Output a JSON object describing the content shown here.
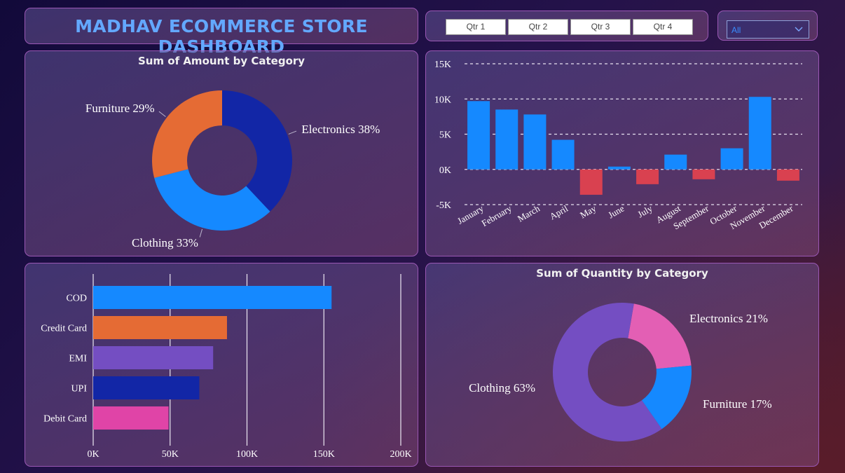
{
  "header": {
    "title": "MADHAV ECOMMERCE STORE DASHBOARD"
  },
  "slicer": {
    "quarters": [
      "Qtr 1",
      "Qtr 2",
      "Qtr 3",
      "Qtr 4"
    ]
  },
  "dropdown": {
    "value": "All"
  },
  "colors": {
    "blue": "#1589ff",
    "navy": "#1226a6",
    "orange": "#e56b34",
    "purple": "#744ec2",
    "pink": "#e044a7",
    "pink_light": "#e35fb4",
    "red": "#d94150",
    "title": "#63a8ff"
  },
  "chart_data": [
    {
      "type": "pie",
      "variant": "donut",
      "title": "Sum of Amount by Category",
      "categories": [
        "Electronics",
        "Clothing",
        "Furniture"
      ],
      "values": [
        38,
        33,
        29
      ],
      "labels": [
        "Electronics 38%",
        "Clothing 33%",
        "Furniture 29%"
      ],
      "colors": [
        "#1226a6",
        "#1589ff",
        "#e56b34"
      ]
    },
    {
      "type": "bar",
      "title": "",
      "categories": [
        "January",
        "February",
        "March",
        "April",
        "May",
        "June",
        "July",
        "August",
        "September",
        "October",
        "November",
        "December"
      ],
      "values": [
        9700,
        8500,
        7800,
        4200,
        -3600,
        400,
        -2100,
        2100,
        -1400,
        3000,
        10300,
        -1600
      ],
      "ylim": [
        -5000,
        15000
      ],
      "yticks": [
        -5000,
        0,
        5000,
        10000,
        15000
      ],
      "ytick_labels": [
        "-5K",
        "0K",
        "5K",
        "10K",
        "15K"
      ],
      "grid": true,
      "positive_color": "#1589ff",
      "negative_color": "#d94150"
    },
    {
      "type": "bar",
      "orientation": "horizontal",
      "title": "",
      "categories": [
        "COD",
        "Credit Card",
        "EMI",
        "UPI",
        "Debit Card"
      ],
      "values": [
        155000,
        87000,
        78000,
        69000,
        49000
      ],
      "xlim": [
        0,
        200000
      ],
      "xticks": [
        0,
        50000,
        100000,
        150000,
        200000
      ],
      "xtick_labels": [
        "0K",
        "50K",
        "100K",
        "150K",
        "200K"
      ],
      "grid": true,
      "colors": [
        "#1589ff",
        "#e56b34",
        "#744ec2",
        "#1226a6",
        "#e044a7"
      ]
    },
    {
      "type": "pie",
      "variant": "donut",
      "title": "Sum of Quantity by Category",
      "categories": [
        "Electronics",
        "Furniture",
        "Clothing"
      ],
      "values": [
        21,
        17,
        63
      ],
      "labels": [
        "Electronics 21%",
        "Furniture 17%",
        "Clothing 63%"
      ],
      "colors": [
        "#e35fb4",
        "#1589ff",
        "#744ec2"
      ]
    }
  ]
}
